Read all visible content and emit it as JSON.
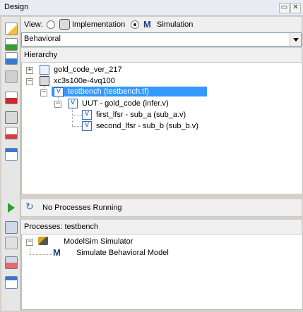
{
  "panel": {
    "title": "Design"
  },
  "view": {
    "label": "View:",
    "implementation_label": "Implementation",
    "simulation_label": "Simulation",
    "selected": "Simulation",
    "dropdown_value": "Behavioral"
  },
  "hierarchy": {
    "header": "Hierarchy",
    "items": [
      {
        "label": "gold_code_ver_217"
      },
      {
        "label": "xc3s100e-4vq100"
      },
      {
        "label": "testbench (testbench.tf)"
      },
      {
        "label": "UUT - gold_code (infer.v)"
      },
      {
        "label": "first_lfsr - sub_a (sub_a.v)"
      },
      {
        "label": "second_lfsr - sub_b (sub_b.v)"
      }
    ]
  },
  "processes": {
    "status": "No Processes Running",
    "header": "Processes: testbench",
    "items": [
      {
        "label": "ModelSim Simulator"
      },
      {
        "label": "Simulate Behavioral Model"
      }
    ]
  },
  "colors": {
    "selection": "#3399ff",
    "accent": "#2d5fad"
  }
}
